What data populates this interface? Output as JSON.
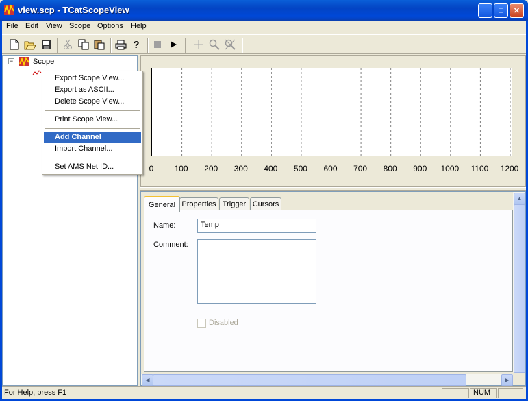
{
  "window": {
    "title": "view.scp - TCatScopeView",
    "min": "_",
    "max": "□",
    "close": "✕"
  },
  "menu": [
    "File",
    "Edit",
    "View",
    "Scope",
    "Options",
    "Help"
  ],
  "toolbar": {
    "icons": [
      "new-icon",
      "open-icon",
      "save-icon",
      "cut-icon",
      "copy-icon",
      "paste-icon",
      "print-icon",
      "help-icon",
      "stop-icon",
      "play-icon",
      "crosshair-icon",
      "zoom-icon",
      "zoom-reset-icon"
    ]
  },
  "tree": {
    "root": "Scope",
    "expander": "−"
  },
  "context_menu": {
    "items": [
      "Export Scope  View...",
      "Export as ASCII...",
      "Delete Scope View...",
      "Print Scope View...",
      "Add Channel",
      "Import Channel...",
      "Set AMS Net ID..."
    ],
    "selected": "Add Channel"
  },
  "chart_data": {
    "type": "line",
    "x_ticks": [
      "0",
      "100",
      "200",
      "300",
      "400",
      "500",
      "600",
      "700",
      "800",
      "900",
      "1000",
      "1100",
      "1200"
    ],
    "xlim": [
      0,
      1200
    ],
    "series": [],
    "grid": "vertical dashed"
  },
  "tabs": [
    "General",
    "Properties",
    "Trigger",
    "Cursors"
  ],
  "active_tab": "General",
  "form": {
    "name_label": "Name:",
    "name_value": "Temp",
    "comment_label": "Comment:",
    "comment_value": "",
    "disabled_label": "Disabled",
    "disabled_checked": false
  },
  "status": {
    "text": "For Help, press F1",
    "num": "NUM"
  }
}
